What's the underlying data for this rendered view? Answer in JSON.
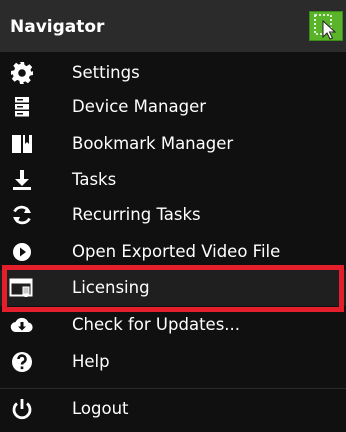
{
  "header": {
    "title": "Navigator",
    "toggle_icon": "cursor-select-icon"
  },
  "items": [
    {
      "label": "Settings",
      "icon": "gear-icon"
    },
    {
      "label": "Device Manager",
      "icon": "server-icon"
    },
    {
      "label": "Bookmark Manager",
      "icon": "bookmark-icon"
    },
    {
      "label": "Tasks",
      "icon": "download-icon"
    },
    {
      "label": "Recurring Tasks",
      "icon": "refresh-icon"
    },
    {
      "label": "Open Exported Video File",
      "icon": "play-circle-icon"
    },
    {
      "label": "Licensing",
      "icon": "license-icon"
    },
    {
      "label": "Check for Updates...",
      "icon": "cloud-download-icon"
    },
    {
      "label": "Help",
      "icon": "help-icon"
    },
    {
      "label": "Logout",
      "icon": "power-icon"
    }
  ],
  "colors": {
    "menu_background": "#101010",
    "header_background": "#2b2b2b",
    "accent_green": "#5ab42a",
    "highlight_red": "#e41e2b"
  }
}
